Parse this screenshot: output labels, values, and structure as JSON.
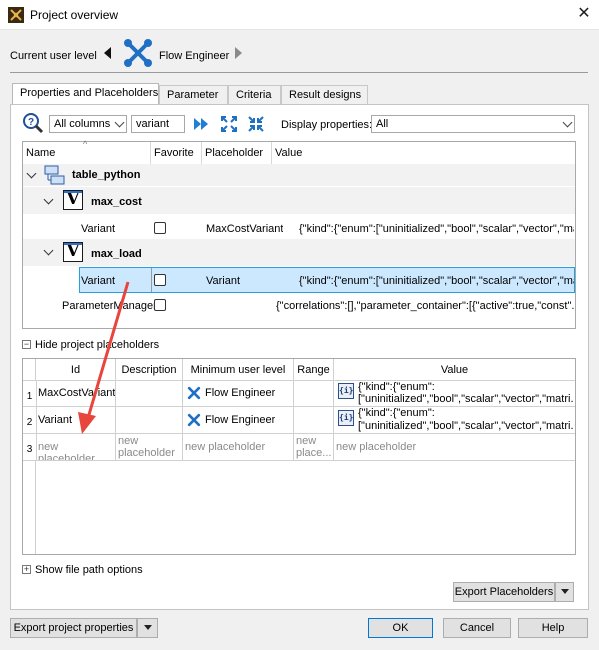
{
  "window": {
    "title": "Project overview",
    "close_label": "✕"
  },
  "user_level": {
    "label": "Current user level",
    "value": "Flow Engineer"
  },
  "tabs": [
    {
      "label": "Properties and Placeholders"
    },
    {
      "label": "Parameter"
    },
    {
      "label": "Criteria"
    },
    {
      "label": "Result designs"
    }
  ],
  "toolbar": {
    "column_filter": "All columns",
    "search_value": "variant",
    "display_label": "Display properties:",
    "display_value": "All"
  },
  "tree": {
    "columns": [
      "Name",
      "Favorite",
      "Placeholder",
      "Value"
    ],
    "root": "table_python",
    "groups": [
      {
        "name": "max_cost",
        "row": {
          "name": "Variant",
          "placeholder": "MaxCostVariant",
          "value": "{\"kind\":{\"enum\":[\"uninitialized\",\"bool\",\"scalar\",\"vector\",\"ma..."
        }
      },
      {
        "name": "max_load",
        "row": {
          "name": "Variant",
          "placeholder": "Variant",
          "value": "{\"kind\":{\"enum\":[\"uninitialized\",\"bool\",\"scalar\",\"vector\",\"ma..."
        }
      }
    ],
    "extra_row": {
      "name": "ParameterManager",
      "value": "{\"correlations\":[],\"parameter_container\":[{\"active\":true,\"const\"..."
    }
  },
  "placeholders": {
    "toggle_label": "Hide project placeholders",
    "columns": [
      "Id",
      "Description",
      "Minimum user level",
      "Range",
      "Value"
    ],
    "rows": [
      {
        "num": "1",
        "id": "MaxCostVariant",
        "level": "Flow Engineer",
        "value1": "{\"kind\":{\"enum\":",
        "value2": "[\"uninitialized\",\"bool\",\"scalar\",\"vector\",\"matri..."
      },
      {
        "num": "2",
        "id": "Variant",
        "level": "Flow Engineer",
        "value1": "{\"kind\":{\"enum\":",
        "value2": "[\"uninitialized\",\"bool\",\"scalar\",\"vector\",\"matri..."
      }
    ],
    "new_row": {
      "num": "3",
      "id": "new placeholder",
      "desc1": "new",
      "desc2": "placeholder",
      "level": "new placeholder",
      "range1": "new",
      "range2": "place...",
      "value": "new placeholder"
    },
    "braces_glyph": "{i}"
  },
  "file_path": {
    "label": "Show file path options"
  },
  "buttons": {
    "export_placeholders": "Export Placeholders",
    "export_project": "Export project properties",
    "ok": "OK",
    "cancel": "Cancel",
    "help": "Help"
  },
  "colors": {
    "selection": "#cce8ff",
    "selection_border": "#26a0da",
    "arrow": "#e8453c",
    "accent": "#0078d7"
  },
  "icons": [
    "app-icon",
    "wrench-icon",
    "search-help-icon",
    "play-forward-icon",
    "expand-icon",
    "collapse-icon",
    "table-icon",
    "v-icon",
    "braces-icon",
    "arrow-annotation"
  ]
}
